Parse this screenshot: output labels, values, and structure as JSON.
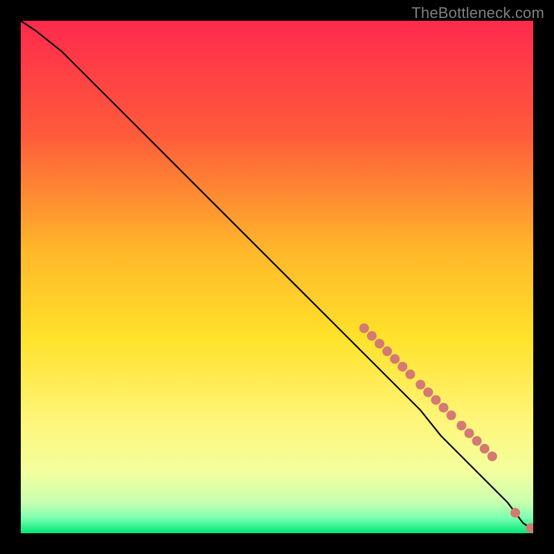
{
  "watermark": "TheBottleneck.com",
  "chart_data": {
    "type": "line",
    "title": "",
    "subtitle": "",
    "xlabel": "",
    "ylabel": "",
    "xlim": [
      0,
      100
    ],
    "ylim": [
      0,
      100
    ],
    "grid": false,
    "legend": false,
    "gradient_colors": {
      "top": "#ff2a4d",
      "quarter": "#ff6a3a",
      "mid": "#ffd500",
      "three_quarter": "#fff57a",
      "near_bottom": "#ecff9b",
      "bottom": "#00e777"
    },
    "series": [
      {
        "name": "bottleneck-curve",
        "type": "line",
        "color": "#000000",
        "x": [
          0,
          3,
          8,
          12,
          18,
          25,
          32,
          40,
          48,
          55,
          62,
          68,
          73,
          78,
          82,
          86,
          90,
          93,
          95,
          96.5,
          98,
          99.5,
          100
        ],
        "y": [
          100,
          98,
          94,
          90,
          84,
          77,
          70,
          62,
          54,
          47,
          40,
          34,
          29,
          24,
          19,
          15,
          11,
          8,
          6,
          4,
          2,
          1,
          1
        ]
      },
      {
        "name": "highlight-points",
        "type": "scatter",
        "color": "#d47a72",
        "x": [
          67,
          68.5,
          70,
          71.5,
          73,
          74.5,
          76,
          78,
          79.5,
          81,
          82.5,
          84,
          86,
          87.5,
          89,
          90.5,
          92,
          96.5,
          99.5,
          100
        ],
        "y": [
          40,
          38.5,
          37,
          35.5,
          34,
          32.5,
          31,
          29,
          27.5,
          26,
          24.5,
          23,
          21,
          19.5,
          18,
          16.5,
          15,
          4,
          1,
          1
        ]
      }
    ]
  }
}
